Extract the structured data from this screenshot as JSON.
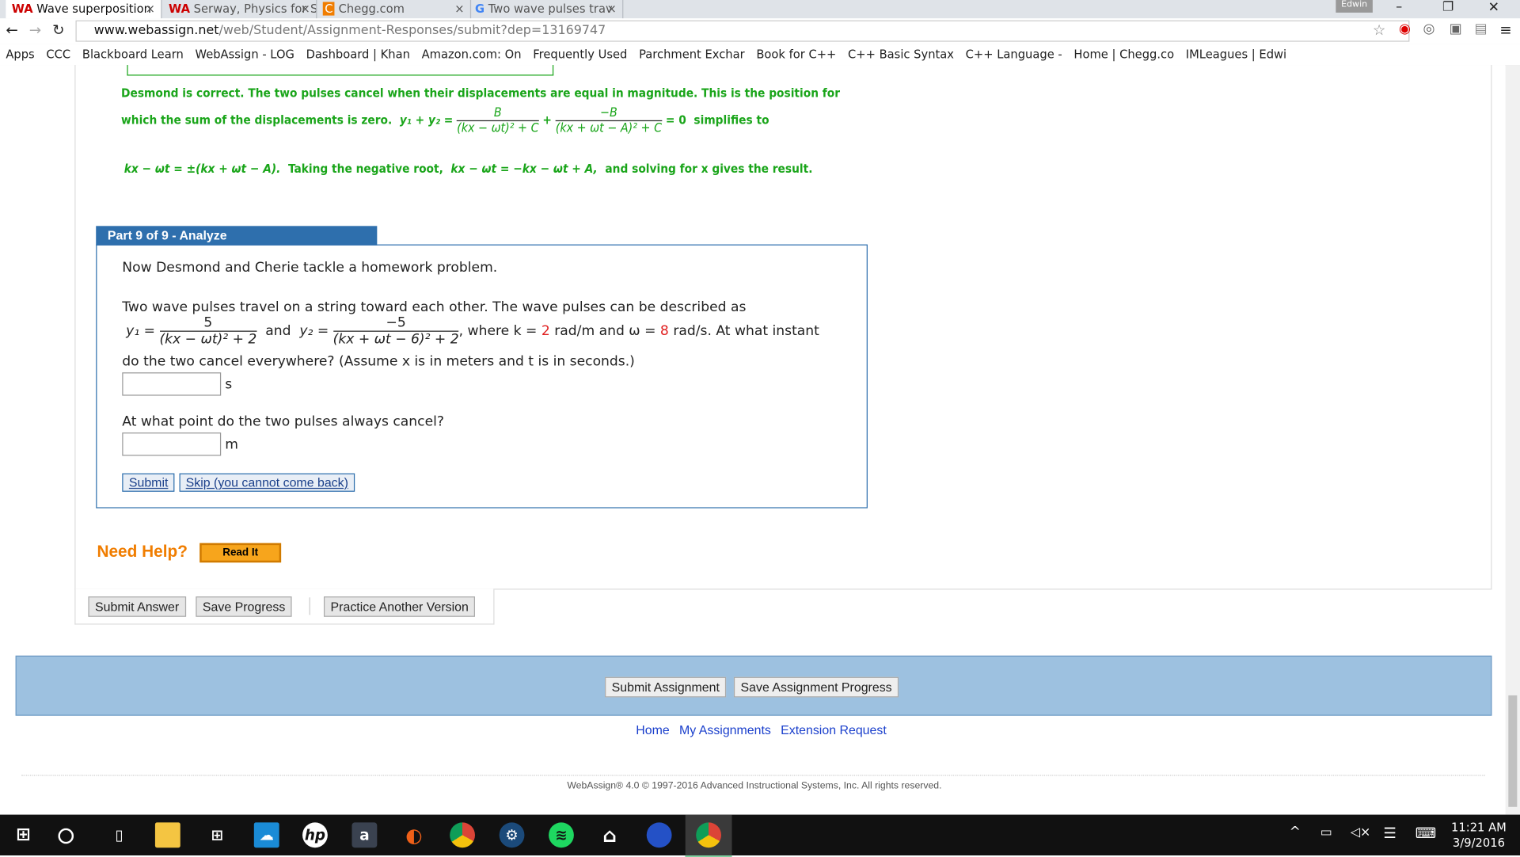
{
  "browser": {
    "tabs": [
      {
        "label": "Wave superposition",
        "active": true
      },
      {
        "label": "Serway, Physics for S"
      },
      {
        "label": "Chegg.com"
      },
      {
        "label": "Two wave pulses trav"
      }
    ],
    "profile": "Edwin",
    "url_domain": "www.webassign.net",
    "url_path": "/web/Student/Assignment-Responses/submit?dep=13169747",
    "bookmarks": [
      "Apps",
      "CCC",
      "Blackboard Learn",
      "WebAssign - LOG",
      "Dashboard | Khan",
      "Amazon.com: On",
      "Frequently Used",
      "Parchment Exchar",
      "Book for C++",
      "C++ Basic Syntax",
      "C++ Language -",
      "Home | Chegg.co",
      "IMLeagues | Edwi"
    ]
  },
  "feedback": {
    "line1": "Desmond is correct. The two pulses cancel when their displacements are equal in magnitude. This is the position for",
    "line2_prefix": "which the sum of the displacements is zero.",
    "eq_lhs": "y₁ + y₂ =",
    "frac1_num": "B",
    "frac1_den": "(kx − ωt)² + C",
    "frac2_num": "−B",
    "frac2_den": "(kx + ωt − A)² + C",
    "eq_rhs": "= 0",
    "simplifies": "simplifies to",
    "line3_eq": "kx − ωt = ±(kx + ωt − A).",
    "line3_mid": "Taking the negative root,",
    "line3_eq2": "kx − ωt = −kx − ωt + A,",
    "line3_end": "and solving for x gives the result."
  },
  "part": {
    "header": "Part 9 of 9 - Analyze",
    "intro": "Now Desmond and Cherie tackle a homework problem.",
    "problem_line1": "Two wave pulses travel on a string toward each other. The wave pulses can be described as",
    "y1": "y₁ =",
    "y1_num": "5",
    "y1_den": "(kx − ωt)² + 2",
    "and": "and",
    "y2": "y₂ =",
    "y2_num": "−5",
    "y2_den": "(kx + ωt − 6)² + 2",
    "where": ", where k =",
    "k": "2",
    "k_unit": "rad/m and ω =",
    "omega": "8",
    "omega_unit": "rad/s. At what instant",
    "problem_line3": "do the two cancel everywhere? (Assume x is in meters and t is in seconds.)",
    "answer1_value": "",
    "answer1_unit": "s",
    "question2": "At what point do the two pulses always cancel?",
    "answer2_value": "",
    "answer2_unit": "m",
    "submit": "Submit",
    "skip": "Skip (you cannot come back)"
  },
  "help": {
    "label": "Need Help?",
    "read_it": "Read It"
  },
  "actions": {
    "submit_answer": "Submit Answer",
    "save_progress": "Save Progress",
    "practice": "Practice Another Version"
  },
  "assignment": {
    "submit": "Submit Assignment",
    "save": "Save Assignment Progress"
  },
  "footer": {
    "links": [
      "Home",
      "My Assignments",
      "Extension Request"
    ],
    "copyright": "WebAssign® 4.0 © 1997-2016 Advanced Instructional Systems, Inc. All rights reserved."
  },
  "taskbar": {
    "time": "11:21 AM",
    "date": "3/9/2016",
    "apps": [
      "windows-start",
      "cortana",
      "task-view",
      "file-explorer",
      "store",
      "onedrive",
      "hp",
      "amazon",
      "origin",
      "chrome",
      "steam",
      "spotify",
      "home",
      "google-earth",
      "chrome-active"
    ]
  },
  "colors": {
    "feedback_green": "#1aa51a",
    "part_header": "#2e6fad",
    "need_help": "#f07d00",
    "highlight_red": "#e02020",
    "assignment_bar": "#9dc1e0"
  }
}
